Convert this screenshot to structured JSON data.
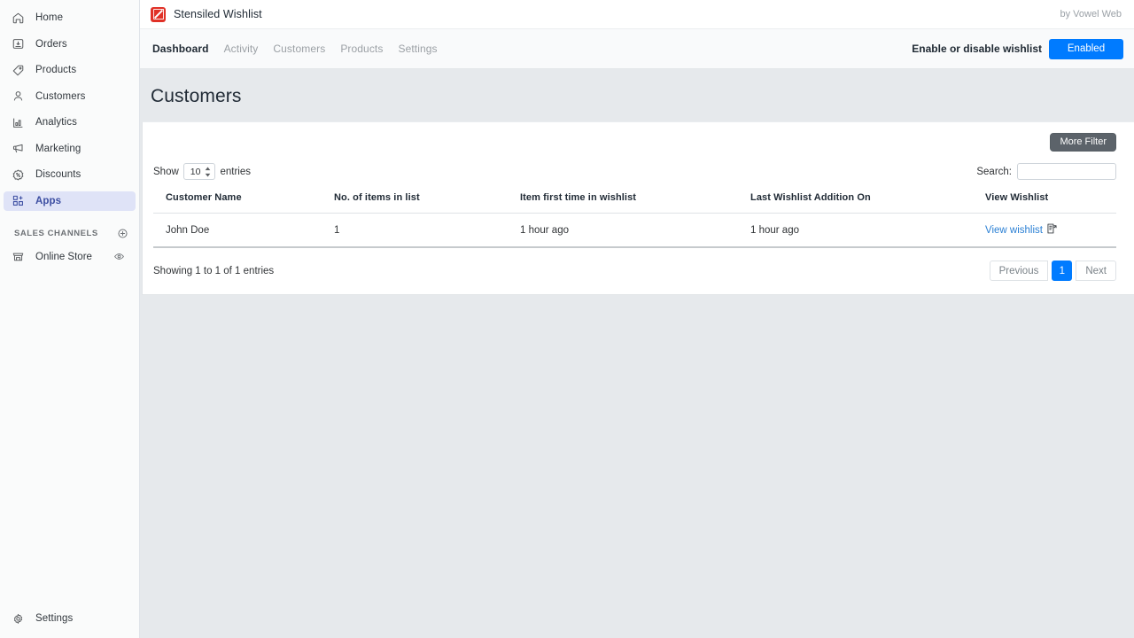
{
  "sidebar": {
    "items": [
      {
        "label": "Home",
        "icon": "home-icon",
        "active": false
      },
      {
        "label": "Orders",
        "icon": "orders-icon",
        "active": false
      },
      {
        "label": "Products",
        "icon": "products-tag-icon",
        "active": false
      },
      {
        "label": "Customers",
        "icon": "customers-person-icon",
        "active": false
      },
      {
        "label": "Analytics",
        "icon": "analytics-bars-icon",
        "active": false
      },
      {
        "label": "Marketing",
        "icon": "marketing-megaphone-icon",
        "active": false
      },
      {
        "label": "Discounts",
        "icon": "discounts-percent-icon",
        "active": false
      },
      {
        "label": "Apps",
        "icon": "apps-grid-icon",
        "active": true
      }
    ],
    "sales_channels": {
      "heading": "SALES CHANNELS",
      "add_icon": "plus-circle-icon",
      "items": [
        {
          "label": "Online Store",
          "icon": "online-store-icon",
          "trailing_icon": "eye-icon"
        }
      ]
    },
    "settings": {
      "label": "Settings",
      "icon": "gear-icon"
    }
  },
  "appbar": {
    "app_name": "Stensiled Wishlist",
    "logo_icon": "stensiled-logo-icon",
    "byline": "by Vowel Web",
    "brand_color": "#e03127"
  },
  "tabbar": {
    "tabs": [
      {
        "label": "Dashboard",
        "active": true
      },
      {
        "label": "Activity",
        "active": false
      },
      {
        "label": "Customers",
        "active": false
      },
      {
        "label": "Products",
        "active": false
      },
      {
        "label": "Settings",
        "active": false
      }
    ],
    "toggle_label": "Enable or disable wishlist",
    "toggle_button": "Enabled",
    "toggle_color": "#007bff"
  },
  "page": {
    "title": "Customers"
  },
  "controls": {
    "more_filter_label": "More Filter",
    "show_prefix": "Show",
    "entries_count": "10",
    "show_suffix": "entries",
    "search_label": "Search:",
    "search_value": "",
    "search_placeholder": ""
  },
  "table": {
    "columns": [
      "Customer Name",
      "No. of items in list",
      "Item first time in wishlist",
      "Last Wishlist Addition On",
      "View Wishlist"
    ],
    "rows": [
      {
        "customer_name": "John Doe",
        "items_in_list": "1",
        "first_time": "1 hour ago",
        "last_addition": "1 hour ago",
        "view_label": "View wishlist",
        "view_icon": "open-document-icon"
      }
    ]
  },
  "footer": {
    "showing_text": "Showing 1 to 1 of 1 entries",
    "previous_label": "Previous",
    "page_number": "1",
    "next_label": "Next"
  }
}
